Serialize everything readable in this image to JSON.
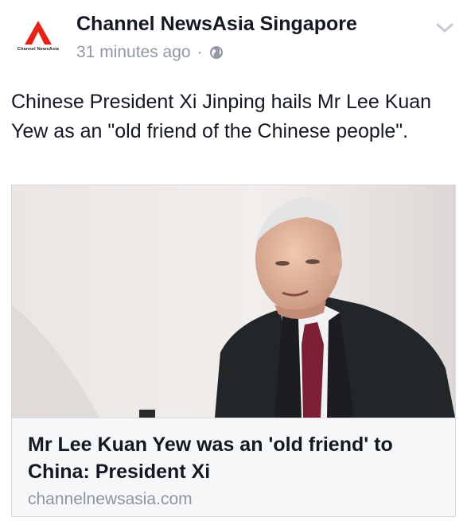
{
  "post": {
    "page_name": "Channel NewsAsia Singapore",
    "logo_text": "Channel NewsAsia",
    "time_ago": "31 minutes ago",
    "separator": "·",
    "privacy_icon": "globe-icon",
    "menu_icon": "chevron-down-icon",
    "message": "Chinese President Xi Jinping hails Mr Lee Kuan Yew as an \"old friend of the Chinese people\"."
  },
  "link_preview": {
    "title": "Mr Lee Kuan Yew was an 'old friend' to China: President Xi",
    "domain": "channelnewsasia.com"
  },
  "colors": {
    "brand_red": "#e2231a",
    "text_primary": "#141823",
    "text_secondary": "#9197a3",
    "card_background": "#f6f7f9"
  }
}
